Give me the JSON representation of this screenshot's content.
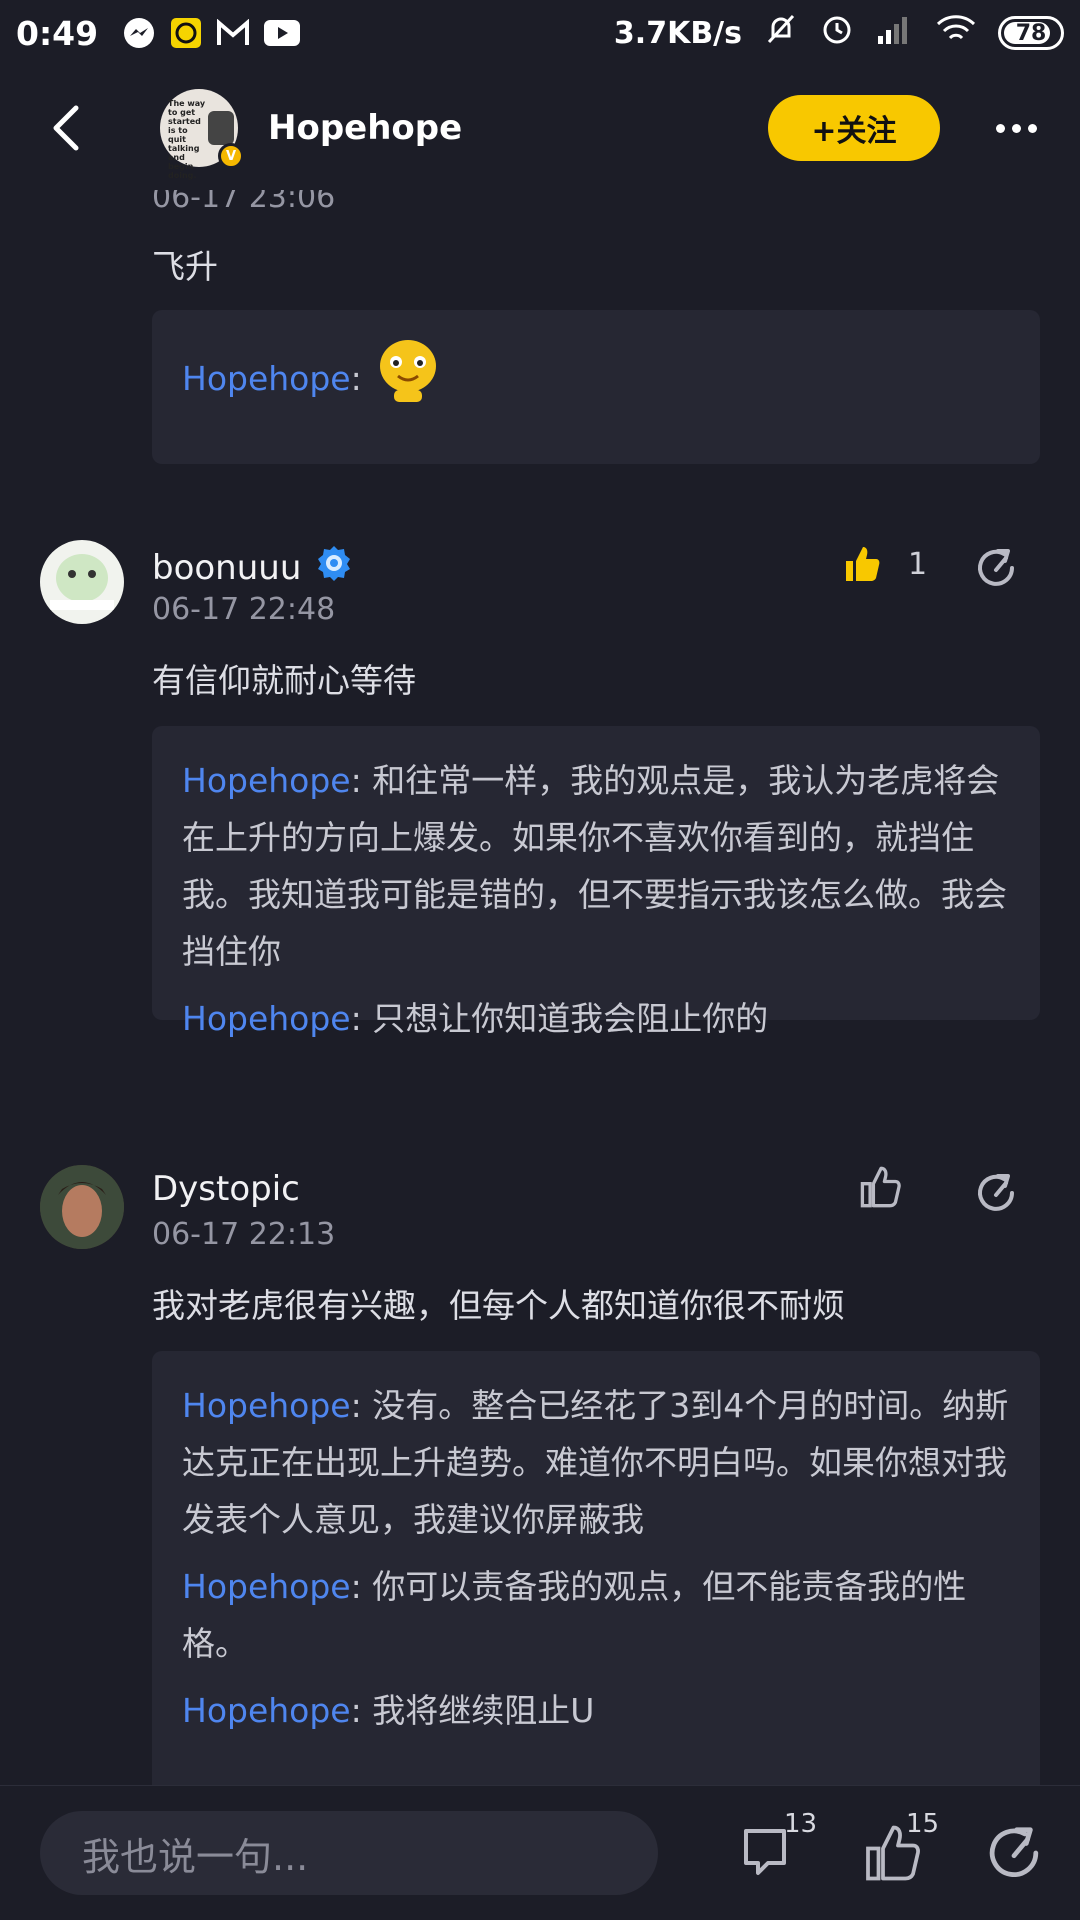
{
  "status_bar": {
    "time": "0:49",
    "net_speed": "3.7KB/s",
    "battery": "78"
  },
  "header": {
    "name": "Hopehope",
    "follow_label": "+关注",
    "avatar_text": "The way to get started is to quit talking and begin doing.",
    "verified_badge": "V"
  },
  "comments": [
    {
      "time": "06-17 23:06",
      "text": "飞升",
      "replies": [
        {
          "name": "Hopehope",
          "sep": ":",
          "text": ""
        }
      ]
    },
    {
      "name": "boonuuu",
      "time": "06-17 22:48",
      "text": "有信仰就耐心等待",
      "like_count": "1",
      "liked": true,
      "replies": [
        {
          "name": "Hopehope",
          "sep": ":",
          "text": "和往常一样，我的观点是，我认为老虎将会在上升的方向上爆发。如果你不喜欢你看到的，就挡住我。我知道我可能是错的，但不要指示我该怎么做。我会挡住你"
        },
        {
          "name": "Hopehope",
          "sep": ":",
          "text": "只想让你知道我会阻止你的"
        }
      ]
    },
    {
      "name": "Dystopic",
      "time": "06-17 22:13",
      "text": "我对老虎很有兴趣，但每个人都知道你很不耐烦",
      "replies": [
        {
          "name": "Hopehope",
          "sep": ":",
          "text": "没有。整合已经花了3到4个月的时间。纳斯达克正在出现上升趋势。难道你不明白吗。如果你想对我发表个人意见，我建议你屏蔽我"
        },
        {
          "name": "Hopehope",
          "sep": ":",
          "text": "你可以责备我的观点，但不能责备我的性格。"
        },
        {
          "name": "Hopehope",
          "sep": ":",
          "text": "我将继续阻止U"
        }
      ]
    }
  ],
  "bottom_bar": {
    "input_placeholder": "我也说一句...",
    "comment_count": "13",
    "like_count": "15"
  },
  "colors": {
    "background": "#1c1d27",
    "card": "#262733",
    "accent_yellow": "#f8c800",
    "reply_name_blue": "#4f86ef"
  },
  "icons": [
    "back-arrow-icon",
    "more-icon",
    "thumbs-up-icon",
    "share-icon",
    "comment-icon",
    "verified-badge-icon",
    "emoji-sticker-icon"
  ]
}
